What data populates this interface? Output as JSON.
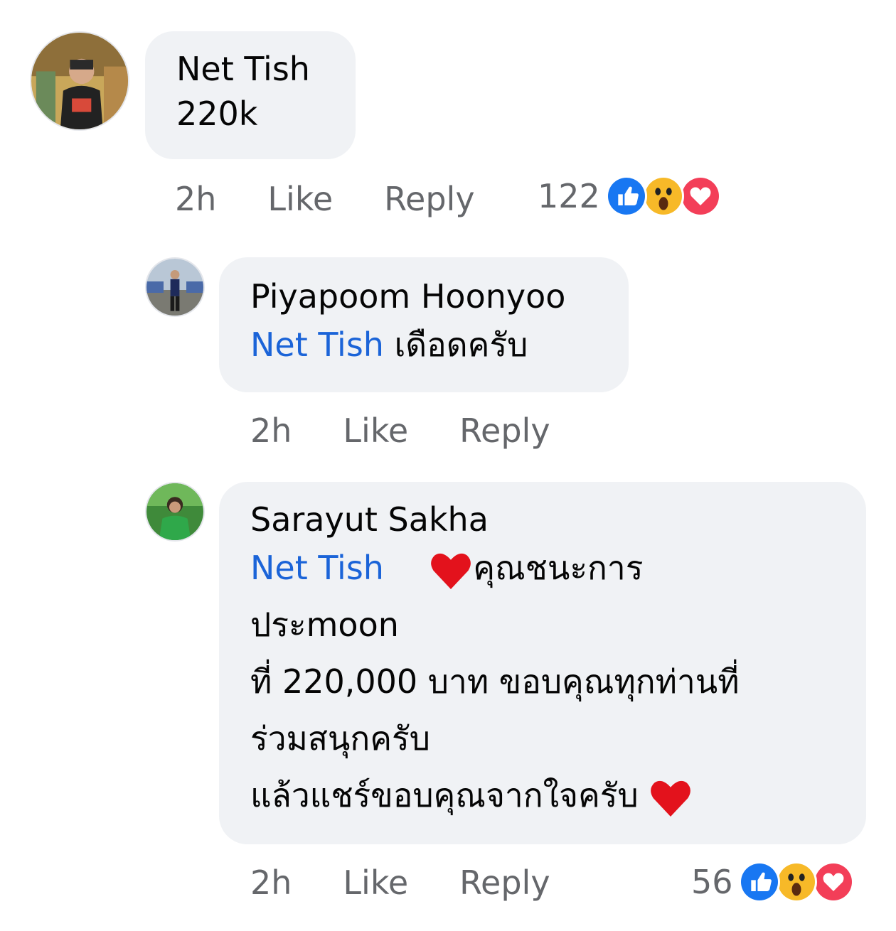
{
  "comments": [
    {
      "author": "Net Tish",
      "line1": "220k",
      "time": "2h",
      "like_label": "Like",
      "reply_label": "Reply",
      "reaction_count": "122",
      "reactions": [
        "like-icon",
        "wow-icon",
        "love-icon"
      ]
    },
    {
      "author": "Piyapoom Hoonyoo",
      "mention": "Net Tish",
      "text": " เดือดครับ",
      "time": "2h",
      "like_label": "Like",
      "reply_label": "Reply"
    },
    {
      "author": "Sarayut Sakha",
      "mention": "Net Tish",
      "line1_rest": "คุณชนะการ",
      "line2": "ประmoon",
      "line3": "ที่ 220,000  บาท ขอบคุณทุกท่านที่",
      "line4": "ร่วมสนุกครับ",
      "line5": "แล้วแชร์ขอบคุณจากใจครับ ",
      "time": "2h",
      "like_label": "Like",
      "reply_label": "Reply",
      "reaction_count": "56",
      "reactions": [
        "like-icon",
        "wow-icon",
        "love-icon"
      ]
    }
  ],
  "colors": {
    "mention": "#1b64d8",
    "bubble": "#f0f2f5",
    "meta": "#65676b",
    "like_blue": "#1877f2",
    "love_red": "#f33e58",
    "wow_yellow": "#f7b928"
  }
}
